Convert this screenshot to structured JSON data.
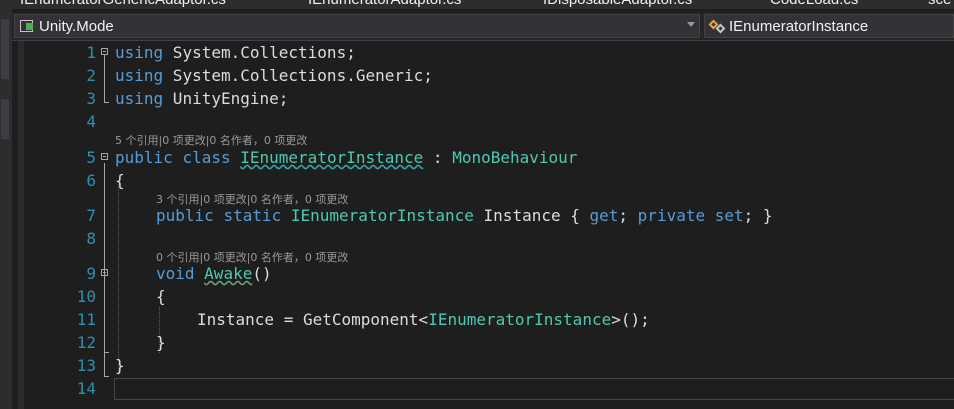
{
  "tabs": [
    "IEnumeratorGenericAdaptor.cs",
    "IEnumeratorAdaptor.cs",
    "IDisposableAdaptor.cs",
    "CodeLoad.cs",
    "sce"
  ],
  "navbar": {
    "project": "Unity.Mode",
    "member": "IEnumeratorInstance"
  },
  "lens": {
    "class": "5 个引用|0 项更改|0 名作者，0 项更改",
    "instance": "3 个引用|0 项更改|0 名作者，0 项更改",
    "awake": "0 个引用|0 项更改|0 名作者，0 项更改"
  },
  "editor": {
    "lines": [
      {
        "n": "1"
      },
      {
        "n": "2"
      },
      {
        "n": "3"
      },
      {
        "n": "4"
      },
      {
        "n": "5"
      },
      {
        "n": "6"
      },
      {
        "n": "7"
      },
      {
        "n": "8"
      },
      {
        "n": "9"
      },
      {
        "n": "10"
      },
      {
        "n": "11"
      },
      {
        "n": "12"
      },
      {
        "n": "13"
      },
      {
        "n": "14"
      }
    ],
    "code": {
      "l1_kw": "using",
      "l1_rest": " System.Collections;",
      "l2_kw": "using",
      "l2_rest": " System.Collections.Generic;",
      "l3_kw": "using",
      "l3_rest": " UnityEngine;",
      "l5_kw1": "public",
      "l5_kw2": "class",
      "l5_name": "IEnumeratorInstance",
      "l5_colon": " : ",
      "l5_base": "MonoBehaviour",
      "l6": "{",
      "l7_kw1": "public",
      "l7_kw2": "static",
      "l7_type": "IEnumeratorInstance",
      "l7_mid": " Instance { ",
      "l7_get": "get",
      "l7_semi": "; ",
      "l7_private": "private",
      "l7_set": "set",
      "l7_end": "; }",
      "l9_kw": "void",
      "l9_name": "Awake",
      "l9_end": "()",
      "l10": "{",
      "l11_a": "Instance = GetComponent<",
      "l11_type": "IEnumeratorInstance",
      "l11_b": ">();",
      "l12": "}",
      "l13": "}"
    }
  }
}
